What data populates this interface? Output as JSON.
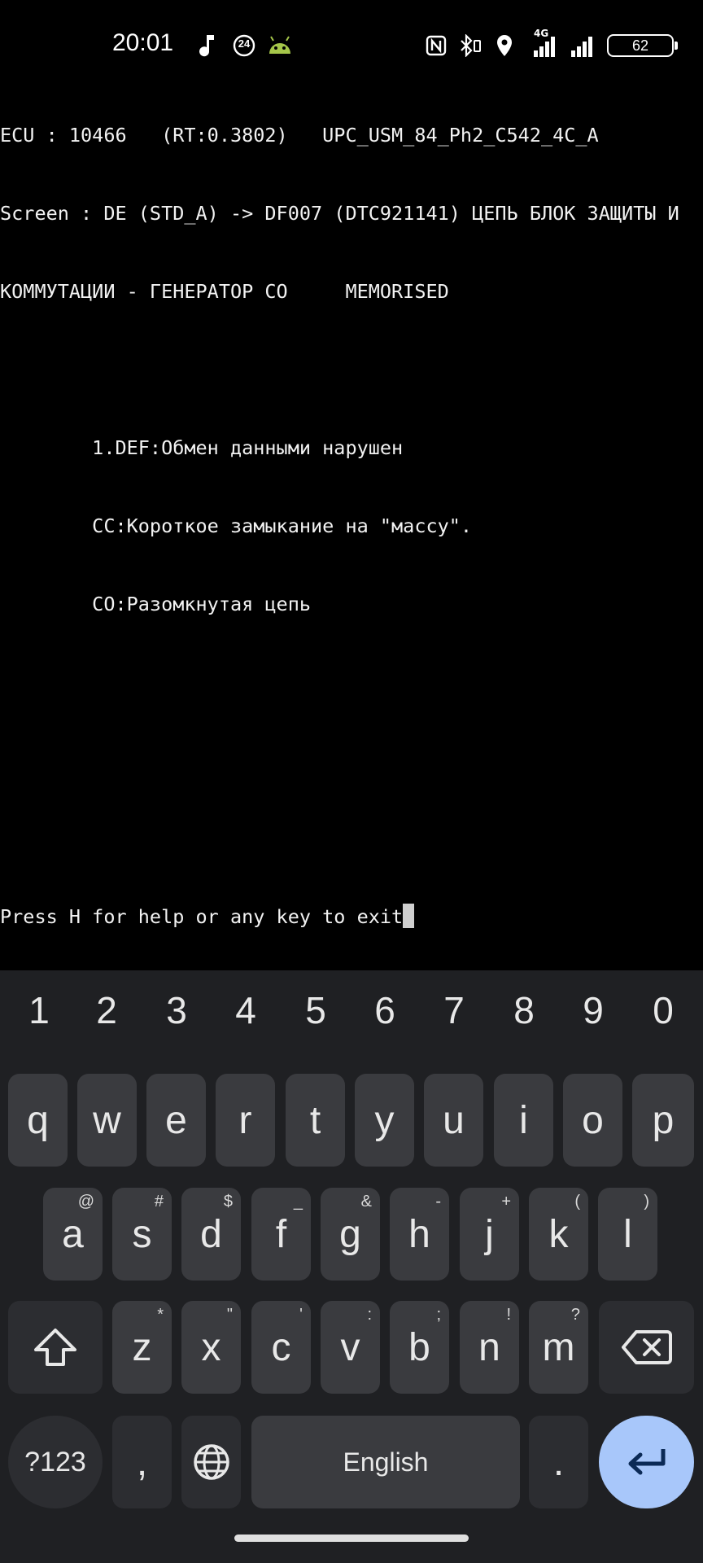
{
  "status_bar": {
    "time": "20:01",
    "left_icons": [
      "music-note-icon",
      "badge-24-icon",
      "android-bot-icon"
    ],
    "net_label": "4G",
    "badge_24": "24",
    "right_icons": [
      "nfc-icon",
      "bluetooth-icon",
      "location-icon",
      "signal-4g-icon",
      "signal-icon"
    ],
    "battery": "62"
  },
  "terminal": {
    "lines": [
      "ECU : 10466   (RT:0.3802)   UPC_USM_84_Ph2_C542_4C_A",
      "Screen : DE (STD_A) -> DF007 (DTC921141) ЦЕПЬ БЛОК ЗАЩИТЫ И",
      "КОММУТАЦИИ - ГЕНЕРАТОР СО     MEMORISED",
      "",
      "        1.DEF:Обмен данными нарушен",
      "        CC:Короткое замыкание на \"массу\".",
      "        CO:Разомкнутая цепь",
      "",
      "",
      "",
      "Press H for help or any key to exit"
    ]
  },
  "keyboard": {
    "numbers": [
      "1",
      "2",
      "3",
      "4",
      "5",
      "6",
      "7",
      "8",
      "9",
      "0"
    ],
    "row1": [
      {
        "label": "q"
      },
      {
        "label": "w"
      },
      {
        "label": "e"
      },
      {
        "label": "r"
      },
      {
        "label": "t"
      },
      {
        "label": "y"
      },
      {
        "label": "u"
      },
      {
        "label": "i"
      },
      {
        "label": "o"
      },
      {
        "label": "p"
      }
    ],
    "row2": [
      {
        "label": "a",
        "hint": "@"
      },
      {
        "label": "s",
        "hint": "#"
      },
      {
        "label": "d",
        "hint": "$"
      },
      {
        "label": "f",
        "hint": "_"
      },
      {
        "label": "g",
        "hint": "&"
      },
      {
        "label": "h",
        "hint": "-"
      },
      {
        "label": "j",
        "hint": "+"
      },
      {
        "label": "k",
        "hint": "("
      },
      {
        "label": "l",
        "hint": ")"
      }
    ],
    "row3": [
      {
        "label": "z",
        "hint": "*"
      },
      {
        "label": "x",
        "hint": "\""
      },
      {
        "label": "c",
        "hint": "'"
      },
      {
        "label": "v",
        "hint": ":"
      },
      {
        "label": "b",
        "hint": ";"
      },
      {
        "label": "n",
        "hint": "!"
      },
      {
        "label": "m",
        "hint": "?"
      }
    ],
    "symbols_label": "?123",
    "comma_label": ",",
    "space_label": "English",
    "period_label": ".",
    "colors": {
      "background": "#1f2023",
      "key": "#3a3b3f",
      "key_dark": "#2c2d31",
      "enter": "#a8c7fa"
    }
  }
}
